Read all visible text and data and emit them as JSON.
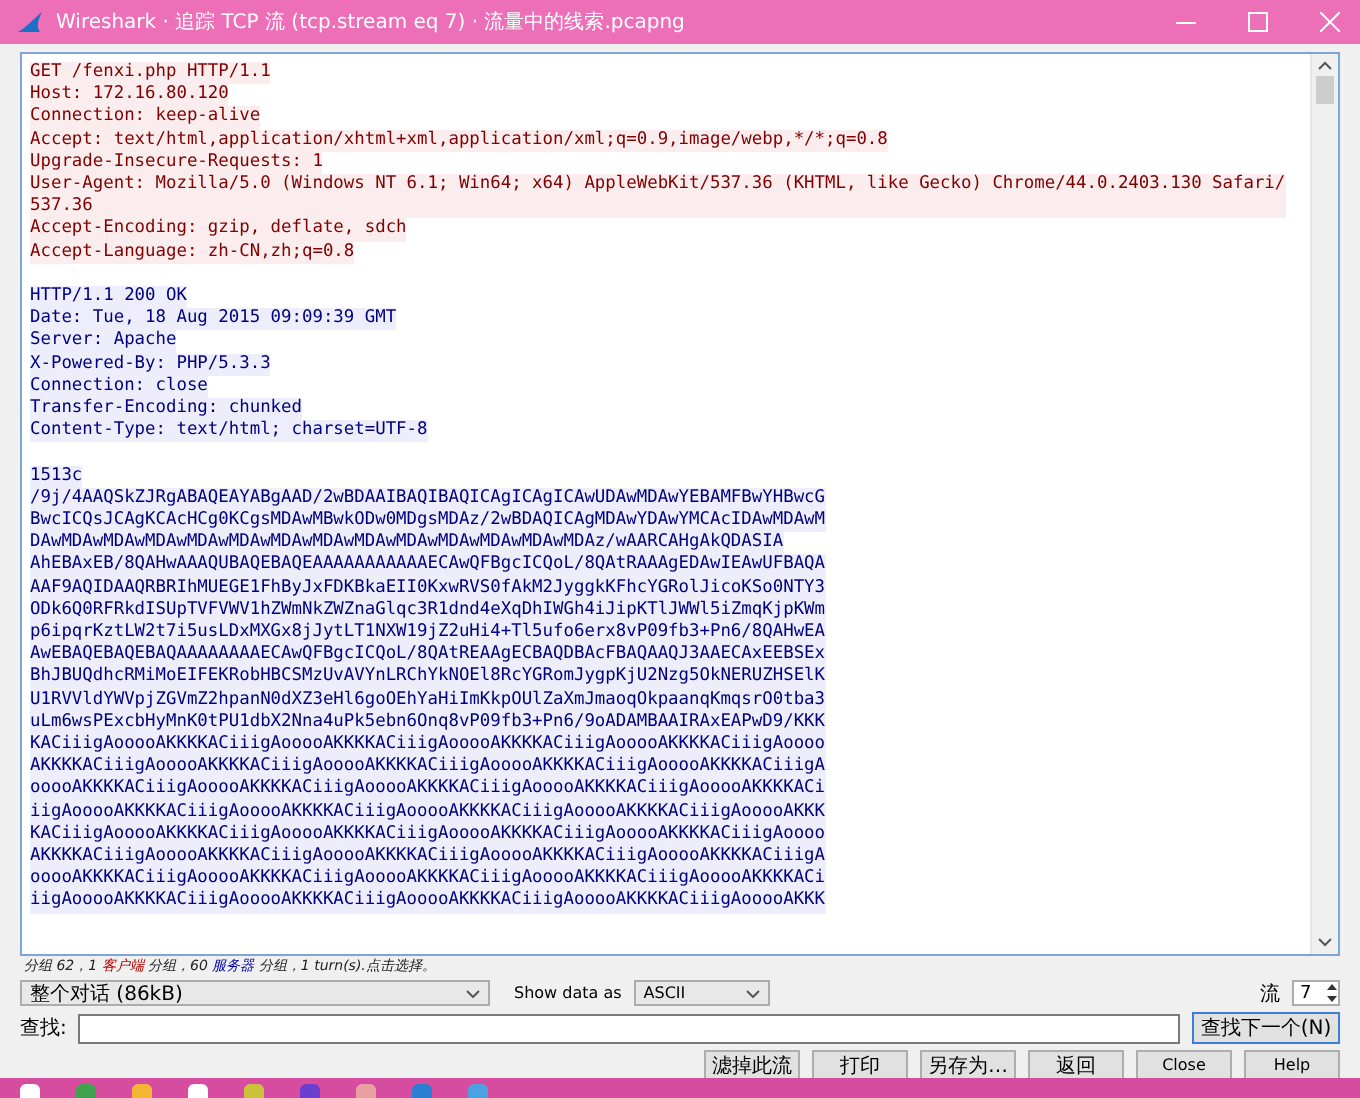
{
  "window": {
    "title": "Wireshark · 追踪 TCP 流 (tcp.stream eq 7) · 流量中的线索.pcapng"
  },
  "stream": [
    {
      "kind": "client",
      "lines": [
        "GET /fenxi.php HTTP/1.1",
        "Host: 172.16.80.120",
        "Connection: keep-alive",
        "Accept: text/html,application/xhtml+xml,application/xml;q=0.9,image/webp,*/*;q=0.8",
        "Upgrade-Insecure-Requests: 1",
        "User-Agent: Mozilla/5.0 (Windows NT 6.1; Win64; x64) AppleWebKit/537.36 (KHTML, like Gecko) Chrome/44.0.2403.130 Safari/537.36",
        "Accept-Encoding: gzip, deflate, sdch",
        "Accept-Language: zh-CN,zh;q=0.8"
      ]
    },
    {
      "kind": "server",
      "lines": [
        "HTTP/1.1 200 OK",
        "Date: Tue, 18 Aug 2015 09:09:39 GMT",
        "Server: Apache",
        "X-Powered-By: PHP/5.3.3",
        "Connection: close",
        "Transfer-Encoding: chunked",
        "Content-Type: text/html; charset=UTF-8"
      ]
    },
    {
      "kind": "server",
      "lines": [
        "1513c",
        "/9j/4AAQSkZJRgABAQEAYABgAAD/2wBDAAIBAQIBAQICAgICAgICAwUDAwMDAwYEBAMFBwYHBwcG",
        "BwcICQsJCAgKCAcHCg0KCgsMDAwMBwkODw0MDgsMDAz/2wBDAQICAgMDAwYDAwYMCAcIDAwMDAwM",
        "DAwMDAwMDAwMDAwMDAwMDAwMDAwMDAwMDAwMDAwMDAwMDAwMDAwMDAz/wAARCAHgAkQDASIA",
        "AhEBAxEB/8QAHwAAAQUBAQEBAQEAAAAAAAAAAAECAwQFBgcICQoL/8QAtRAAAgEDAwIEAwUFBAQA",
        "AAF9AQIDAAQRBRIhMUEGE1FhByJxFDKBkaEII0KxwRVS0fAkM2JyggkKFhcYGRolJicoKSo0NTY3",
        "ODk6Q0RFRkdISUpTVFVWV1hZWmNkZWZnaGlqc3R1dnd4eXqDhIWGh4iJipKTlJWWl5iZmqKjpKWm",
        "p6ipqrKztLW2t7i5usLDxMXGx8jJytLT1NXW19jZ2uHi4+Tl5ufo6erx8vP09fb3+Pn6/8QAHwEA",
        "AwEBAQEBAQEBAQAAAAAAAAECAwQFBgcICQoL/8QAtREAAgECBAQDBAcFBAQAAQJ3AAECAxEEBSEx",
        "BhJBUQdhcRMiMoEIFEKRobHBCSMzUvAVYnLRChYkNOEl8RcYGRomJygpKjU2Nzg5OkNERUZHSElK",
        "U1RVVldYWVpjZGVmZ2hpanN0dXZ3eHl6goOEhYaHiImKkpOUlZaXmJmaoqOkpaanqKmqsrO0tba3",
        "uLm6wsPExcbHyMnK0tPU1dbX2Nna4uPk5ebn6Onq8vP09fb3+Pn6/9oADAMBAAIRAxEAPwD9/KKK",
        "KACiiigAooooAKKKKACiiigAooooAKKKKACiiigAooooAKKKKACiiigAooooAKKKKACiiigAoooo",
        "AKKKKACiiigAooooAKKKKACiiigAooooAKKKKACiiigAooooAKKKKACiiigAooooAKKKKACiiigA",
        "ooooAKKKKACiiigAooooAKKKKACiiigAooooAKKKKACiiigAooooAKKKKACiiigAooooAKKKKACi",
        "iigAooooAKKKKACiiigAooooAKKKKACiiigAooooAKKKKACiiigAooooAKKKKACiiigAooooAKKK",
        "KACiiigAooooAKKKKACiiigAooooAKKKKACiiigAooooAKKKKACiiigAooooAKKKKACiiigAoooo",
        "AKKKKACiiigAooooAKKKKACiiigAooooAKKKKACiiigAooooAKKKKACiiigAooooAKKKKACiiigA",
        "ooooAKKKKACiiigAooooAKKKKACiiigAooooAKKKKACiiigAooooAKKKKACiiigAooooAKKKKACi",
        "iigAooooAKKKKACiiigAooooAKKKKACiiigAooooAKKKKACiiigAooooAKKKKACiiigAooooAKKK"
      ]
    }
  ],
  "status": [
    {
      "text": "分组 62，1 ",
      "kind": "plain"
    },
    {
      "text": "客户端",
      "kind": "client"
    },
    {
      "text": " 分组，60 ",
      "kind": "plain"
    },
    {
      "text": "服务器",
      "kind": "server"
    },
    {
      "text": " 分组，1 turn(s).点击选择。",
      "kind": "plain"
    }
  ],
  "conversation_select": {
    "value": "整个对话 (86kB)"
  },
  "show_data_as": {
    "label": "Show data as",
    "value": "ASCII"
  },
  "stream_number": {
    "label": "流",
    "value": "7"
  },
  "find": {
    "label": "查找:",
    "button": "查找下一个(N)"
  },
  "buttons": [
    "滤掉此流",
    "打印",
    "另存为…",
    "返回",
    "Close",
    "Help"
  ]
}
